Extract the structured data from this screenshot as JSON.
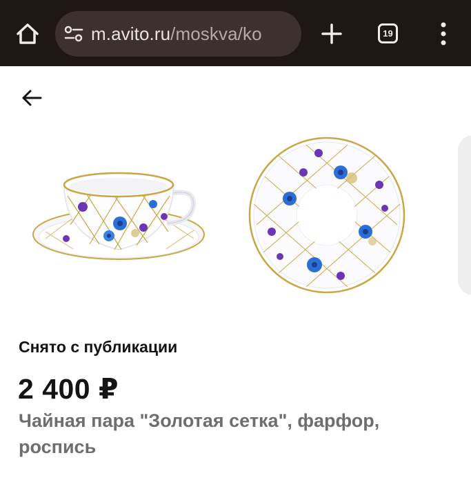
{
  "browser": {
    "url_host": "m.avito.ru",
    "url_path": "/moskva/ko",
    "tab_count": "19",
    "icons": {
      "home": "home-icon",
      "site_settings": "site-settings-icon",
      "new_tab": "plus-icon",
      "tabs": "tab-switcher-icon",
      "menu": "more-vert-icon"
    }
  },
  "page": {
    "back_icon": "arrow-left-icon",
    "gallery": {
      "photos": [
        "teacup-with-saucer-photo",
        "saucer-top-view-photo",
        "next-photo-preview"
      ]
    },
    "status_text": "Снято с публикации",
    "price": "2 400 ₽",
    "title": "Чайная пара \"Золотая сетка\", фарфор, роспись"
  },
  "colors": {
    "browser_bar": "#1e1714",
    "url_pill": "#3b322d",
    "text_primary": "#141414",
    "text_secondary": "#6e6e6e",
    "porcelain_gold": "#c9a544",
    "flower_blue": "#2b6fd6",
    "flower_violet": "#6a36b5"
  }
}
